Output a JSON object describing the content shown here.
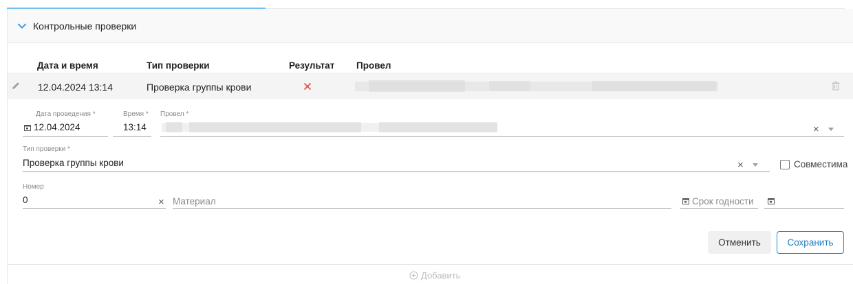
{
  "section": {
    "title": "Контрольные проверки",
    "expanded": true
  },
  "table": {
    "columns": [
      "Дата и время",
      "Тип проверки",
      "Результат",
      "Провел"
    ],
    "rows": [
      {
        "datetime": "12.04.2024 13:14",
        "type": "Проверка группы крови",
        "result": "fail",
        "performer": ""
      }
    ]
  },
  "form": {
    "date_label": "Дата проведения *",
    "date_value": "12.04.2024",
    "time_label": "Время *",
    "time_value": "13:14",
    "performer_label": "Провел *",
    "check_type_label": "Тип проверки *",
    "check_type_value": "Проверка группы крови",
    "compatible_label": "Совместима",
    "compatible_checked": false,
    "number_label": "Номер",
    "number_value": "0",
    "material_placeholder": "Материал",
    "expiry_placeholder": "Срок годности"
  },
  "buttons": {
    "cancel": "Отменить",
    "save": "Сохранить"
  },
  "footer": {
    "add_label": "Добавить"
  },
  "colors": {
    "accent": "#6ec1f0",
    "fail": "#f44336",
    "primary": "#1e88d2"
  }
}
